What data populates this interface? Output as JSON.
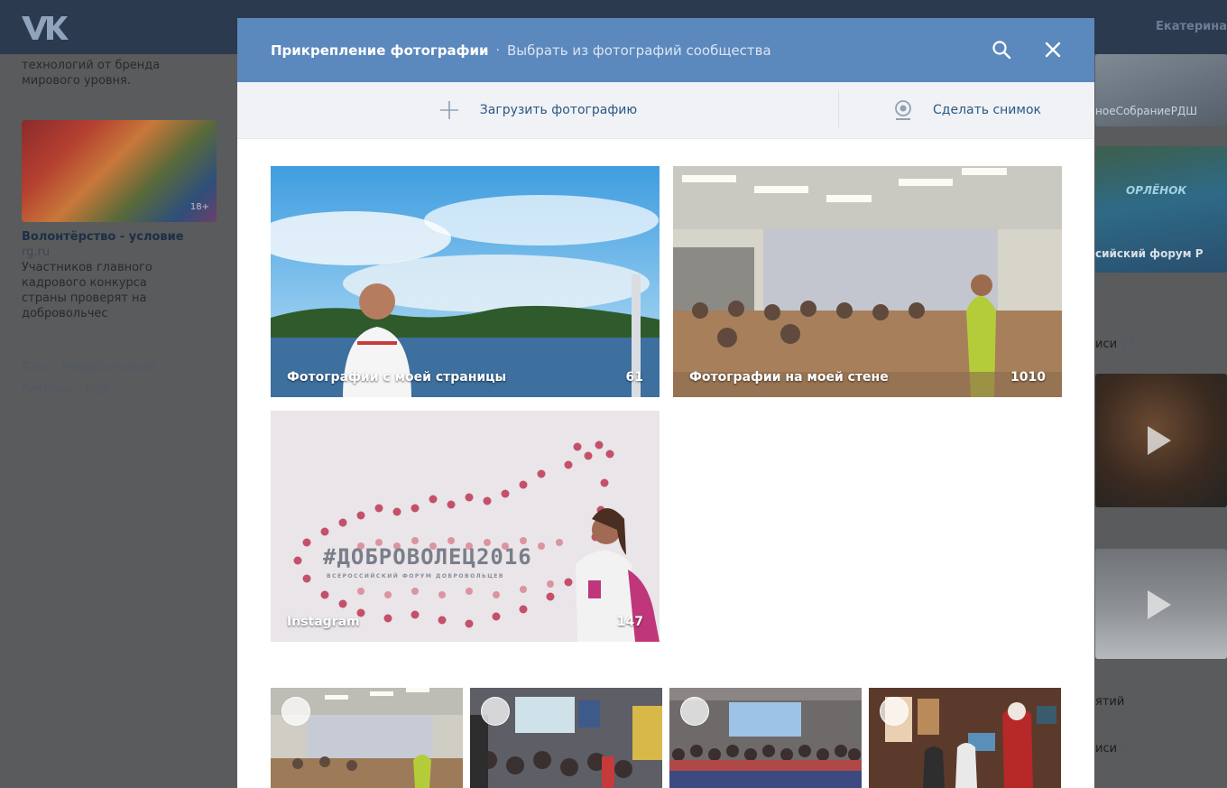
{
  "background_page": {
    "user_name": "Екатерина",
    "left_column": {
      "text_top_line1": "технологий от бренда",
      "text_top_line2": "мирового уровня.",
      "age_badge": "18+",
      "news_title": "Волонтёрство - условие",
      "news_source": "rg.ru",
      "news_text_lines": [
        "Участников главного",
        "кадрового конкурса",
        "страны проверят на",
        "добровольчес"
      ],
      "footer_links": [
        "Блог",
        "Разработчикам",
        "Реклама",
        "Ещё ⌄"
      ]
    },
    "right_column": {
      "banner_text": "ноеСобраниеРДШ",
      "forum_label": "сийский форум Р",
      "orlyonok": "ОРЛЁНОК",
      "posts_1_label": "иси",
      "posts_1_count": "77",
      "event_label": "ятий",
      "posts_2_label": "иси",
      "posts_2_count": "5"
    }
  },
  "modal": {
    "title": "Прикрепление фотографии",
    "separator": "·",
    "subtitle": "Выбрать из фотографий сообщества",
    "toolbar": {
      "upload_label": "Загрузить фотографию",
      "snapshot_label": "Сделать снимок"
    },
    "albums": [
      {
        "label": "Фотографии с моей страницы",
        "count": "61"
      },
      {
        "label": "Фотографии на моей стене",
        "count": "1010"
      },
      {
        "label": "Instagram",
        "count": "147"
      }
    ],
    "instagram_banner": {
      "hashtag": "#ДОБРОВОЛЕЦ2016",
      "subtext": "ВСЕРОССИЙСКИЙ ФОРУМ ДОБРОВОЛЬЦЕВ"
    },
    "photos": [
      {
        "name": "classroom"
      },
      {
        "name": "auditorium"
      },
      {
        "name": "crowd-hall"
      },
      {
        "name": "new-year-party"
      }
    ]
  },
  "colors": {
    "modal_header": "#5b88bd",
    "link_blue": "#2a5885",
    "page_header": "#2b3a4f"
  }
}
